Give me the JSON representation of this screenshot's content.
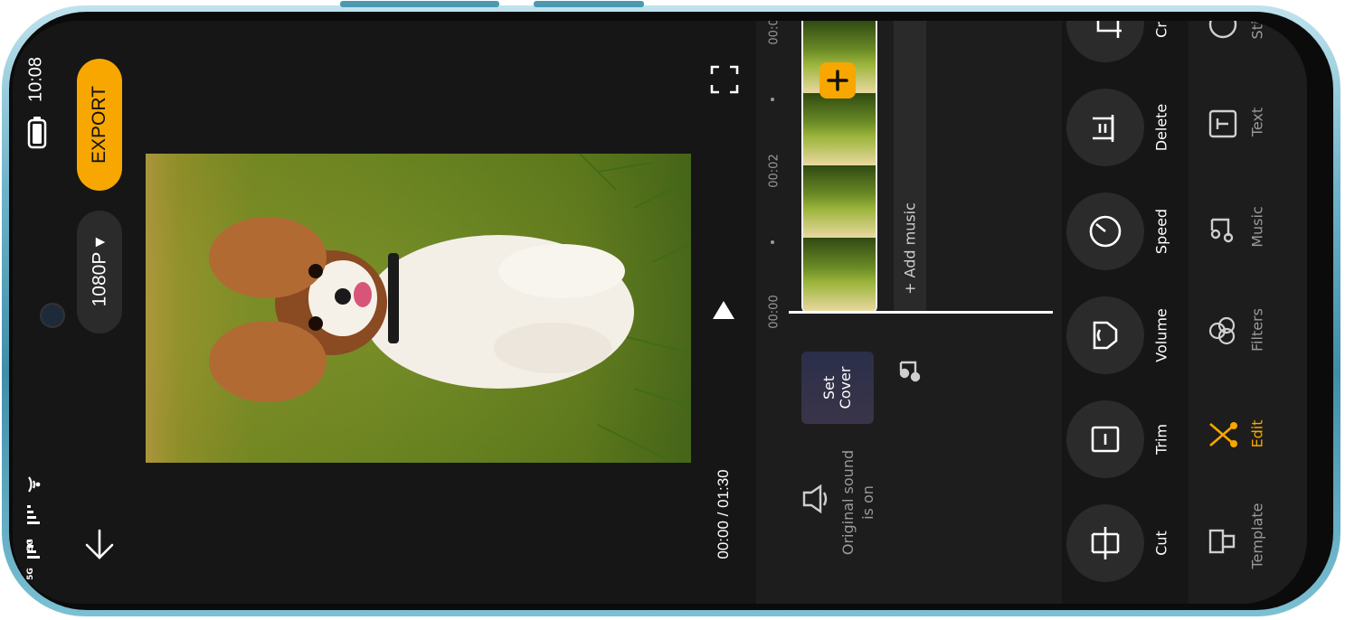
{
  "status_bar": {
    "time": "10:08",
    "network_1": "5G",
    "network_2": "5G"
  },
  "header": {
    "export_label": "EXPORT",
    "resolution_label": "1080P ▾"
  },
  "player": {
    "timecode": "00:00 / 01:30"
  },
  "timeline": {
    "ticks": [
      "00:00",
      "00:02",
      "00:0"
    ],
    "add_music_label": "+ Add music",
    "set_cover_label": "Set Cover",
    "original_sound_label": "Original sound is on"
  },
  "edit_tools": [
    {
      "label": "Cut",
      "icon": "cut-icon"
    },
    {
      "label": "Trim",
      "icon": "trim-icon"
    },
    {
      "label": "Volume",
      "icon": "volume-icon"
    },
    {
      "label": "Speed",
      "icon": "speed-icon"
    },
    {
      "label": "Delete",
      "icon": "delete-icon"
    },
    {
      "label": "Cr",
      "icon": "crop-icon"
    }
  ],
  "bottom_tabs": [
    {
      "label": "Template",
      "icon": "template-icon"
    },
    {
      "label": "Edit",
      "icon": "scissors-icon",
      "active": true
    },
    {
      "label": "Filters",
      "icon": "filters-icon"
    },
    {
      "label": "Music",
      "icon": "music-icon"
    },
    {
      "label": "Text",
      "icon": "text-icon"
    },
    {
      "label": "Sti",
      "icon": "sticker-icon"
    }
  ],
  "colors": {
    "accent": "#f7a700",
    "background": "#161616",
    "panel": "#1e1e1e",
    "circle_button": "#2b2b2b"
  }
}
